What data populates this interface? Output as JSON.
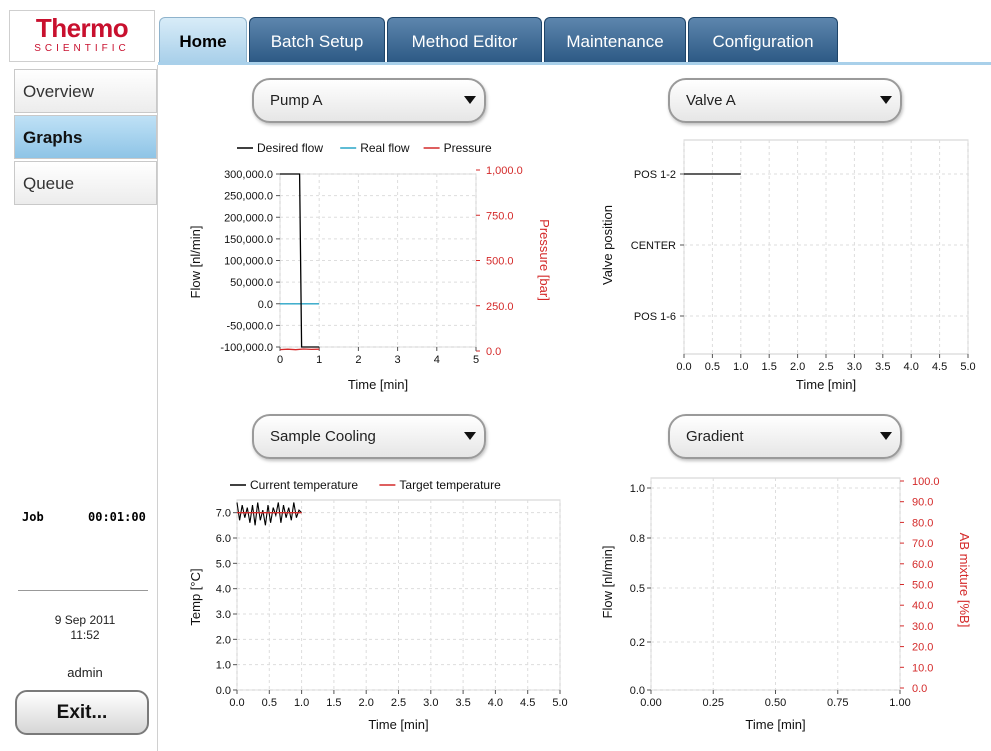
{
  "logo": {
    "brand": "Thermo",
    "sub": "SCIENTIFIC"
  },
  "tabs": [
    {
      "label": "Home",
      "active": true
    },
    {
      "label": "Batch Setup",
      "active": false
    },
    {
      "label": "Method Editor",
      "active": false
    },
    {
      "label": "Maintenance",
      "active": false
    },
    {
      "label": "Configuration",
      "active": false
    }
  ],
  "sidebar": {
    "items": [
      {
        "label": "Overview",
        "active": false
      },
      {
        "label": "Graphs",
        "active": true
      },
      {
        "label": "Queue",
        "active": false
      }
    ],
    "job_label": "Job",
    "job_time": "00:01:00",
    "date": "9 Sep 2011",
    "time": "11:52",
    "user": "admin",
    "exit_label": "Exit..."
  },
  "dropdowns": {
    "pump": "Pump A",
    "valve": "Valve A",
    "cooling": "Sample Cooling",
    "gradient": "Gradient"
  },
  "colors": {
    "desired": "#000000",
    "real": "#2aa5c7",
    "pressure": "#d42a2a",
    "current": "#000000",
    "target": "#d42a2a"
  },
  "chart_data": [
    {
      "type": "line",
      "name": "pump",
      "legend": [
        "Desired flow",
        "Real flow",
        "Pressure"
      ],
      "xlabel": "Time [min]",
      "ylabel": "Flow [nl/min]",
      "y2label": "Pressure [bar]",
      "xlim": [
        0,
        5
      ],
      "ylim": [
        -100000,
        300000
      ],
      "y2lim": [
        0,
        1000
      ],
      "xticks": [
        "0",
        "1",
        "2",
        "3",
        "4",
        "5"
      ],
      "yticks": [
        "300,000.0",
        "250,000.0",
        "200,000.0",
        "150,000.0",
        "100,000.0",
        "50,000.0",
        "0.0",
        "-50,000.0",
        "-100,000.0"
      ],
      "y2ticks": [
        "1,000.0",
        "750.0",
        "500.0",
        "250.0",
        "0.0"
      ],
      "series": [
        {
          "name": "Desired flow",
          "axis": "left",
          "x": [
            0,
            0.5,
            0.55,
            1.0
          ],
          "y": [
            300000,
            300000,
            -100000,
            -100000
          ]
        },
        {
          "name": "Real flow",
          "axis": "left",
          "x": [
            0,
            1.0
          ],
          "y": [
            0,
            0
          ]
        },
        {
          "name": "Pressure",
          "axis": "right",
          "x": [
            0,
            0.2,
            0.4,
            0.6,
            0.8,
            1.0
          ],
          "y": [
            8,
            10,
            7,
            11,
            9,
            10
          ]
        }
      ]
    },
    {
      "type": "line",
      "name": "valve",
      "xlabel": "Time [min]",
      "ylabel": "Valve position",
      "xlim": [
        0,
        5
      ],
      "xticks": [
        "0.0",
        "0.5",
        "1.0",
        "1.5",
        "2.0",
        "2.5",
        "3.0",
        "3.5",
        "4.0",
        "4.5",
        "5.0"
      ],
      "categories": [
        "POS 1-2",
        "CENTER",
        "POS 1-6"
      ],
      "series": [
        {
          "name": "position",
          "x": [
            0,
            1.0
          ],
          "y": [
            "POS 1-2",
            "POS 1-2"
          ]
        }
      ]
    },
    {
      "type": "line",
      "name": "cooling",
      "legend": [
        "Current temperature",
        "Target temperature"
      ],
      "xlabel": "Time [min]",
      "ylabel": "Temp [°C]",
      "xlim": [
        0,
        5
      ],
      "ylim": [
        0,
        7.5
      ],
      "xticks": [
        "0.0",
        "0.5",
        "1.0",
        "1.5",
        "2.0",
        "2.5",
        "3.0",
        "3.5",
        "4.0",
        "4.5",
        "5.0"
      ],
      "yticks": [
        "7.0",
        "6.0",
        "5.0",
        "4.0",
        "3.0",
        "2.0",
        "1.0",
        "0.0"
      ],
      "series": [
        {
          "name": "Current temperature",
          "x": [
            0,
            0.04,
            0.08,
            0.12,
            0.16,
            0.2,
            0.24,
            0.28,
            0.32,
            0.36,
            0.4,
            0.44,
            0.48,
            0.52,
            0.56,
            0.6,
            0.64,
            0.68,
            0.72,
            0.76,
            0.8,
            0.84,
            0.88,
            0.92,
            0.96,
            1.0
          ],
          "y": [
            7.4,
            6.7,
            7.3,
            6.8,
            7.2,
            6.6,
            7.3,
            6.5,
            7.4,
            6.7,
            7.1,
            6.5,
            7.3,
            6.6,
            7.2,
            6.9,
            7.4,
            6.6,
            7.3,
            6.8,
            7.2,
            6.7,
            7.4,
            6.8,
            7.1,
            7.0
          ]
        },
        {
          "name": "Target temperature",
          "x": [
            0,
            1.0
          ],
          "y": [
            7.0,
            7.0
          ]
        }
      ]
    },
    {
      "type": "line",
      "name": "gradient",
      "xlabel": "Time [min]",
      "ylabel": "Flow [nl/min]",
      "y2label": "AB mixture [%B]",
      "xlim": [
        0,
        1
      ],
      "ylim": [
        0,
        1
      ],
      "y2lim": [
        0,
        100
      ],
      "xticks": [
        "0.00",
        "0.25",
        "0.50",
        "0.75",
        "1.00"
      ],
      "yticks": [
        "1.0",
        "0.8",
        "0.5",
        "0.2",
        "0.0"
      ],
      "y2ticks": [
        "100.0",
        "90.0",
        "80.0",
        "70.0",
        "60.0",
        "50.0",
        "40.0",
        "30.0",
        "20.0",
        "10.0",
        "0.0"
      ],
      "series": []
    }
  ]
}
